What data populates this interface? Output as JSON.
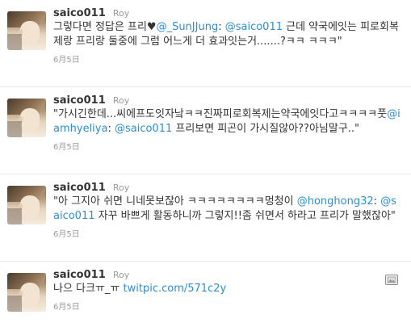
{
  "tweets": [
    {
      "screen_name": "saico011",
      "full_name": "Roy",
      "text_parts": [
        "그렇다면 정답은 프리♥",
        "@_SunJJung",
        ": ",
        "@saico011",
        " 근데 약국에잇는 피로회복제랑 프리랑 둘중에 그럼 어느게 더 효과잇는거.......?ㅋㅋ ㅋㅋㅋ\""
      ],
      "timestamp": "6月5日"
    },
    {
      "screen_name": "saico011",
      "full_name": "Roy",
      "text_parts": [
        "\"가시긴한데...씨에프도잇자낰ㅋㅋ진짜피로회복제는약국에잇다고ㅋㅋㅋㅋ풋",
        "@iamhyeliya",
        ": ",
        "@saico011",
        " 프리보면 피곤이 가시질않아??아님말구..\""
      ],
      "timestamp": "6月5日"
    },
    {
      "screen_name": "saico011",
      "full_name": "Roy",
      "text_parts": [
        "\"아 그지아 쉬면 니네못보잖아 ㅋㅋㅋㅋㅋㅋㅋㅋ멍청이 ",
        "@honghong32",
        ": ",
        "@saico011",
        " 자꾸 바쁘게 활동하니까 그렇지!!좀 쉬면서 하라고 프리가 말했잖아\""
      ],
      "timestamp": "6月5日"
    },
    {
      "screen_name": "saico011",
      "full_name": "Roy",
      "text_parts": [
        "나으 다크ㅠ_ㅠ ",
        "twitpic.com/571c2y"
      ],
      "timestamp": "6月5日",
      "media_icon": "image-icon"
    }
  ],
  "colors": {
    "link": "#2b8fcf",
    "text": "#333333",
    "meta": "#999999",
    "divider": "#e8e8e8"
  }
}
